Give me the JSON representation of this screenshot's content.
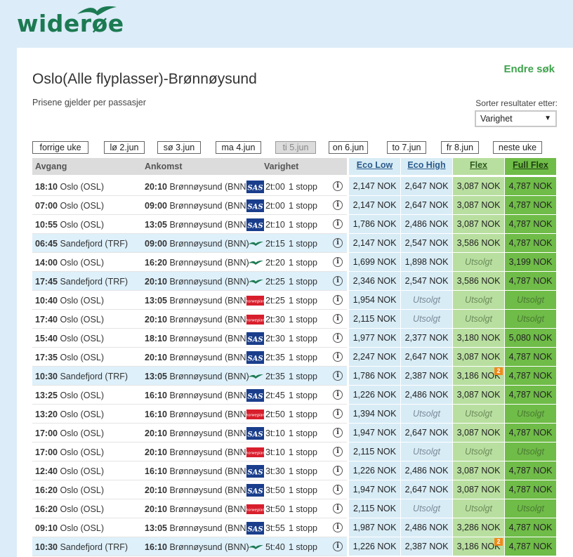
{
  "brand": {
    "name": "wideroe_logo"
  },
  "header": {
    "title": "Oslo(Alle flyplasser)-Brønnøysund",
    "subtitle": "Prisene gjelder per passasjer",
    "change_search": "Endre søk",
    "sort_label": "Sorter resultater etter:",
    "sort_value": "Varighet"
  },
  "dates": [
    "forrige uke",
    "lø 2.jun",
    "sø 3.jun",
    "ma 4.jun",
    "ti 5.jun",
    "on 6.jun",
    "to 7.jun",
    "fr 8.jun",
    "neste uke"
  ],
  "active_date_index": 4,
  "columns": {
    "dep": "Avgang",
    "arr": "Ankomst",
    "dur": "Varighet",
    "eco_low": "Eco Low",
    "eco_high": "Eco High",
    "flex": "Flex",
    "full_flex": "Full Flex"
  },
  "airline_icons": {
    "sas": "sas-logo",
    "wideroe": "wideroe-bird-logo",
    "norwegian": "norwegian-logo"
  },
  "colors": {
    "brand_green": "#1c7a52",
    "eco": "#d8ecf6",
    "flex": "#b9dfa0",
    "full_flex": "#6fbc48"
  },
  "flights": [
    {
      "dep_time": "18:10",
      "dep_place": "Oslo (OSL)",
      "arr_time": "20:10",
      "arr_place": "Brønnøysund (BNN)",
      "airline": "sas",
      "duration": "2t:00",
      "stops": "1 stopp",
      "hl": false,
      "eco_low": "2,147 NOK",
      "eco_high": "2,647 NOK",
      "flex": "3,087 NOK",
      "full_flex": "4,787 NOK",
      "badge": ""
    },
    {
      "dep_time": "07:00",
      "dep_place": "Oslo (OSL)",
      "arr_time": "09:00",
      "arr_place": "Brønnøysund (BNN)",
      "airline": "sas",
      "duration": "2t:00",
      "stops": "1 stopp",
      "hl": false,
      "eco_low": "2,147 NOK",
      "eco_high": "2,647 NOK",
      "flex": "3,087 NOK",
      "full_flex": "4,787 NOK",
      "badge": ""
    },
    {
      "dep_time": "10:55",
      "dep_place": "Oslo (OSL)",
      "arr_time": "13:05",
      "arr_place": "Brønnøysund (BNN)",
      "airline": "sas",
      "duration": "2t:10",
      "stops": "1 stopp",
      "hl": false,
      "eco_low": "1,786 NOK",
      "eco_high": "2,486 NOK",
      "flex": "3,087 NOK",
      "full_flex": "4,787 NOK",
      "badge": ""
    },
    {
      "dep_time": "06:45",
      "dep_place": "Sandefjord (TRF)",
      "arr_time": "09:00",
      "arr_place": "Brønnøysund (BNN)",
      "airline": "wideroe",
      "duration": "2t:15",
      "stops": "1 stopp",
      "hl": true,
      "eco_low": "2,147 NOK",
      "eco_high": "2,547 NOK",
      "flex": "3,586 NOK",
      "full_flex": "4,787 NOK",
      "badge": ""
    },
    {
      "dep_time": "14:00",
      "dep_place": "Oslo (OSL)",
      "arr_time": "16:20",
      "arr_place": "Brønnøysund (BNN)",
      "airline": "wideroe",
      "duration": "2t:20",
      "stops": "1 stopp",
      "hl": false,
      "eco_low": "1,699 NOK",
      "eco_high": "1,898 NOK",
      "flex": "Utsolgt",
      "full_flex": "3,199 NOK",
      "badge": ""
    },
    {
      "dep_time": "17:45",
      "dep_place": "Sandefjord (TRF)",
      "arr_time": "20:10",
      "arr_place": "Brønnøysund (BNN)",
      "airline": "wideroe",
      "duration": "2t:25",
      "stops": "1 stopp",
      "hl": true,
      "eco_low": "2,346 NOK",
      "eco_high": "2,547 NOK",
      "flex": "3,586 NOK",
      "full_flex": "4,787 NOK",
      "badge": ""
    },
    {
      "dep_time": "10:40",
      "dep_place": "Oslo (OSL)",
      "arr_time": "13:05",
      "arr_place": "Brønnøysund (BNN)",
      "airline": "norwegian",
      "duration": "2t:25",
      "stops": "1 stopp",
      "hl": false,
      "eco_low": "1,954 NOK",
      "eco_high": "Utsolgt",
      "flex": "Utsolgt",
      "full_flex": "Utsolgt",
      "badge": ""
    },
    {
      "dep_time": "17:40",
      "dep_place": "Oslo (OSL)",
      "arr_time": "20:10",
      "arr_place": "Brønnøysund (BNN)",
      "airline": "norwegian",
      "duration": "2t:30",
      "stops": "1 stopp",
      "hl": false,
      "eco_low": "2,115 NOK",
      "eco_high": "Utsolgt",
      "flex": "Utsolgt",
      "full_flex": "Utsolgt",
      "badge": ""
    },
    {
      "dep_time": "15:40",
      "dep_place": "Oslo (OSL)",
      "arr_time": "18:10",
      "arr_place": "Brønnøysund (BNN)",
      "airline": "sas",
      "duration": "2t:30",
      "stops": "1 stopp",
      "hl": false,
      "eco_low": "1,977 NOK",
      "eco_high": "2,377 NOK",
      "flex": "3,180 NOK",
      "full_flex": "5,080 NOK",
      "badge": ""
    },
    {
      "dep_time": "17:35",
      "dep_place": "Oslo (OSL)",
      "arr_time": "20:10",
      "arr_place": "Brønnøysund (BNN)",
      "airline": "sas",
      "duration": "2t:35",
      "stops": "1 stopp",
      "hl": false,
      "eco_low": "2,247 NOK",
      "eco_high": "2,647 NOK",
      "flex": "3,087 NOK",
      "full_flex": "4,787 NOK",
      "badge": ""
    },
    {
      "dep_time": "10:30",
      "dep_place": "Sandefjord (TRF)",
      "arr_time": "13:05",
      "arr_place": "Brønnøysund (BNN)",
      "airline": "wideroe",
      "duration": "2t:35",
      "stops": "1 stopp",
      "hl": true,
      "eco_low": "1,786 NOK",
      "eco_high": "2,387 NOK",
      "flex": "3,186 NOK",
      "full_flex": "4,787 NOK",
      "badge": "2"
    },
    {
      "dep_time": "13:25",
      "dep_place": "Oslo (OSL)",
      "arr_time": "16:10",
      "arr_place": "Brønnøysund (BNN)",
      "airline": "sas",
      "duration": "2t:45",
      "stops": "1 stopp",
      "hl": false,
      "eco_low": "1,226 NOK",
      "eco_high": "2,486 NOK",
      "flex": "3,087 NOK",
      "full_flex": "4,787 NOK",
      "badge": ""
    },
    {
      "dep_time": "13:20",
      "dep_place": "Oslo (OSL)",
      "arr_time": "16:10",
      "arr_place": "Brønnøysund (BNN)",
      "airline": "norwegian",
      "duration": "2t:50",
      "stops": "1 stopp",
      "hl": false,
      "eco_low": "1,394 NOK",
      "eco_high": "Utsolgt",
      "flex": "Utsolgt",
      "full_flex": "Utsolgt",
      "badge": ""
    },
    {
      "dep_time": "17:00",
      "dep_place": "Oslo (OSL)",
      "arr_time": "20:10",
      "arr_place": "Brønnøysund (BNN)",
      "airline": "sas",
      "duration": "3t:10",
      "stops": "1 stopp",
      "hl": false,
      "eco_low": "1,947 NOK",
      "eco_high": "2,647 NOK",
      "flex": "3,087 NOK",
      "full_flex": "4,787 NOK",
      "badge": ""
    },
    {
      "dep_time": "17:00",
      "dep_place": "Oslo (OSL)",
      "arr_time": "20:10",
      "arr_place": "Brønnøysund (BNN)",
      "airline": "norwegian",
      "duration": "3t:10",
      "stops": "1 stopp",
      "hl": false,
      "eco_low": "2,115 NOK",
      "eco_high": "Utsolgt",
      "flex": "Utsolgt",
      "full_flex": "Utsolgt",
      "badge": ""
    },
    {
      "dep_time": "12:40",
      "dep_place": "Oslo (OSL)",
      "arr_time": "16:10",
      "arr_place": "Brønnøysund (BNN)",
      "airline": "sas",
      "duration": "3t:30",
      "stops": "1 stopp",
      "hl": false,
      "eco_low": "1,226 NOK",
      "eco_high": "2,486 NOK",
      "flex": "3,087 NOK",
      "full_flex": "4,787 NOK",
      "badge": ""
    },
    {
      "dep_time": "16:20",
      "dep_place": "Oslo (OSL)",
      "arr_time": "20:10",
      "arr_place": "Brønnøysund (BNN)",
      "airline": "sas",
      "duration": "3t:50",
      "stops": "1 stopp",
      "hl": false,
      "eco_low": "1,947 NOK",
      "eco_high": "2,647 NOK",
      "flex": "3,087 NOK",
      "full_flex": "4,787 NOK",
      "badge": ""
    },
    {
      "dep_time": "16:20",
      "dep_place": "Oslo (OSL)",
      "arr_time": "20:10",
      "arr_place": "Brønnøysund (BNN)",
      "airline": "norwegian",
      "duration": "3t:50",
      "stops": "1 stopp",
      "hl": false,
      "eco_low": "2,115 NOK",
      "eco_high": "Utsolgt",
      "flex": "Utsolgt",
      "full_flex": "Utsolgt",
      "badge": ""
    },
    {
      "dep_time": "09:10",
      "dep_place": "Oslo (OSL)",
      "arr_time": "13:05",
      "arr_place": "Brønnøysund (BNN)",
      "airline": "sas",
      "duration": "3t:55",
      "stops": "1 stopp",
      "hl": false,
      "eco_low": "1,987 NOK",
      "eco_high": "2,486 NOK",
      "flex": "3,286 NOK",
      "full_flex": "4,787 NOK",
      "badge": ""
    },
    {
      "dep_time": "10:30",
      "dep_place": "Sandefjord (TRF)",
      "arr_time": "16:10",
      "arr_place": "Brønnøysund (BNN)",
      "airline": "wideroe",
      "duration": "5t:40",
      "stops": "1 stopp",
      "hl": true,
      "eco_low": "1,226 NOK",
      "eco_high": "2,387 NOK",
      "flex": "3,186 NOK",
      "full_flex": "4,787 NOK",
      "badge": "2"
    }
  ]
}
